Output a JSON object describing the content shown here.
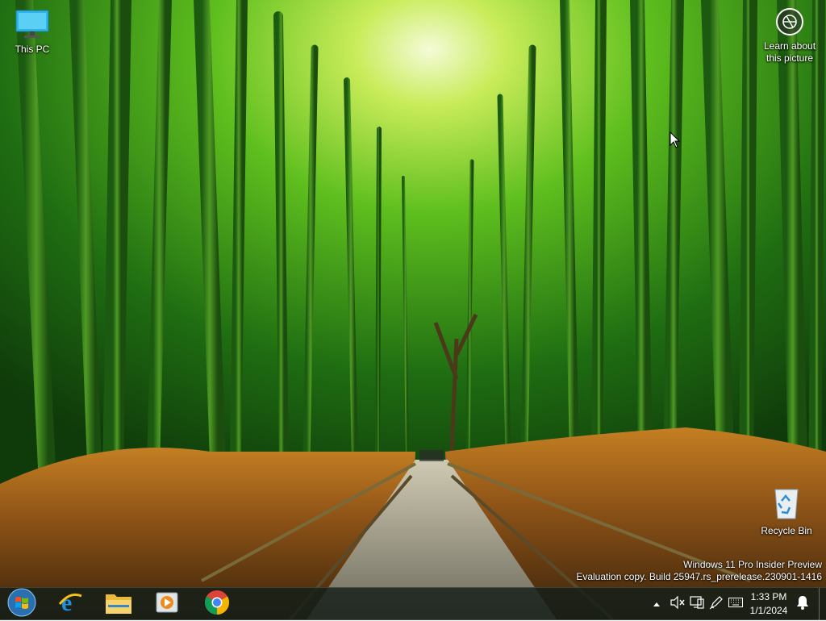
{
  "desktop": {
    "icons": [
      {
        "label": "This PC"
      },
      {
        "label": "Recycle Bin"
      }
    ],
    "learn_about": "Learn about this picture",
    "watermark": {
      "line1": "Windows 11 Pro Insider Preview",
      "line2": "Evaluation copy. Build 25947.rs_prerelease.230901-1416"
    }
  },
  "taskbar": {
    "pinned": [
      {
        "icon": "windows-start-icon"
      },
      {
        "icon": "internet-explorer-icon"
      },
      {
        "icon": "file-explorer-icon"
      },
      {
        "icon": "media-player-icon"
      },
      {
        "icon": "chrome-icon"
      }
    ],
    "tray": {
      "icons": [
        "show-hidden-icons-chevron",
        "volume-muted-icon",
        "network-icon",
        "pen-icon",
        "keyboard-icon"
      ],
      "time": "1:33 PM",
      "date": "1/1/2024",
      "notifications_icon": "notification-bell-icon"
    }
  }
}
